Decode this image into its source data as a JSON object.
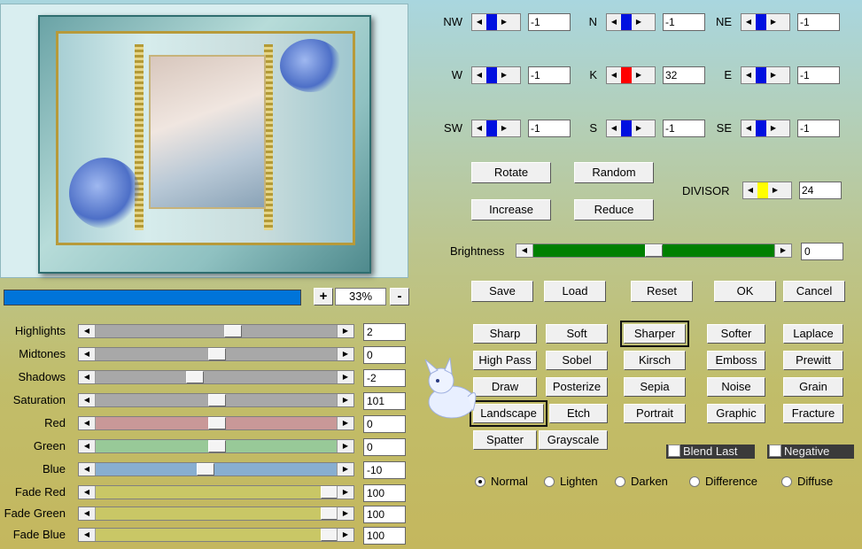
{
  "preview": {
    "zoom": "33%",
    "zoom_in": "+",
    "zoom_out": "-"
  },
  "sliders": [
    {
      "label": "Highlights",
      "value": "2",
      "pos": 0.57,
      "track": "#a8a8a8"
    },
    {
      "label": "Midtones",
      "value": "0",
      "pos": 0.5,
      "track": "#a8a8a8"
    },
    {
      "label": "Shadows",
      "value": "-2",
      "pos": 0.4,
      "track": "#a8a8a8"
    },
    {
      "label": "Saturation",
      "value": "101",
      "pos": 0.5,
      "track": "#a8a8a8"
    },
    {
      "label": "Red",
      "value": "0",
      "pos": 0.5,
      "track": "#c99898"
    },
    {
      "label": "Green",
      "value": "0",
      "pos": 0.5,
      "track": "#98c998"
    },
    {
      "label": "Blue",
      "value": "-10",
      "pos": 0.45,
      "track": "#88aed0"
    },
    {
      "label": "Fade Red",
      "value": "100",
      "pos": 1.0,
      "track": "#c9c766"
    },
    {
      "label": "Fade Green",
      "value": "100",
      "pos": 1.0,
      "track": "#c9c766"
    },
    {
      "label": "Fade Blue",
      "value": "100",
      "pos": 1.0,
      "track": "#c9c766"
    }
  ],
  "matrix": [
    {
      "label": "NW",
      "value": "-1"
    },
    {
      "label": "N",
      "value": "-1"
    },
    {
      "label": "NE",
      "value": "-1"
    },
    {
      "label": "W",
      "value": "-1"
    },
    {
      "label": "K",
      "value": "32"
    },
    {
      "label": "E",
      "value": "-1"
    },
    {
      "label": "SW",
      "value": "-1"
    },
    {
      "label": "S",
      "value": "-1"
    },
    {
      "label": "SE",
      "value": "-1"
    }
  ],
  "buttons": {
    "rotate": "Rotate",
    "random": "Random",
    "increase": "Increase",
    "reduce": "Reduce",
    "save": "Save",
    "load": "Load",
    "reset": "Reset",
    "ok": "OK",
    "cancel": "Cancel"
  },
  "divisor": {
    "label": "DIVISOR",
    "value": "24"
  },
  "brightness": {
    "label": "Brightness",
    "value": "0",
    "pos": 0.5
  },
  "filters": [
    "Sharp",
    "Soft",
    "Sharper",
    "Softer",
    "Laplace",
    "High Pass",
    "Sobel",
    "Kirsch",
    "Emboss",
    "Prewitt",
    "Draw",
    "Posterize",
    "Sepia",
    "Noise",
    "Grain",
    "Landscape",
    "Etch",
    "Portrait",
    "Graphic",
    "Fracture",
    "Spatter",
    "Grayscale"
  ],
  "checks": {
    "blend_last": "Blend Last",
    "negative": "Negative"
  },
  "modes": [
    "Normal",
    "Lighten",
    "Darken",
    "Difference",
    "Diffuse"
  ],
  "colors": {
    "progress": "#0074d9",
    "indicator": "#0010e0",
    "center": "#ff0000",
    "divisor": "#ffff00",
    "brightness": "#008000"
  }
}
